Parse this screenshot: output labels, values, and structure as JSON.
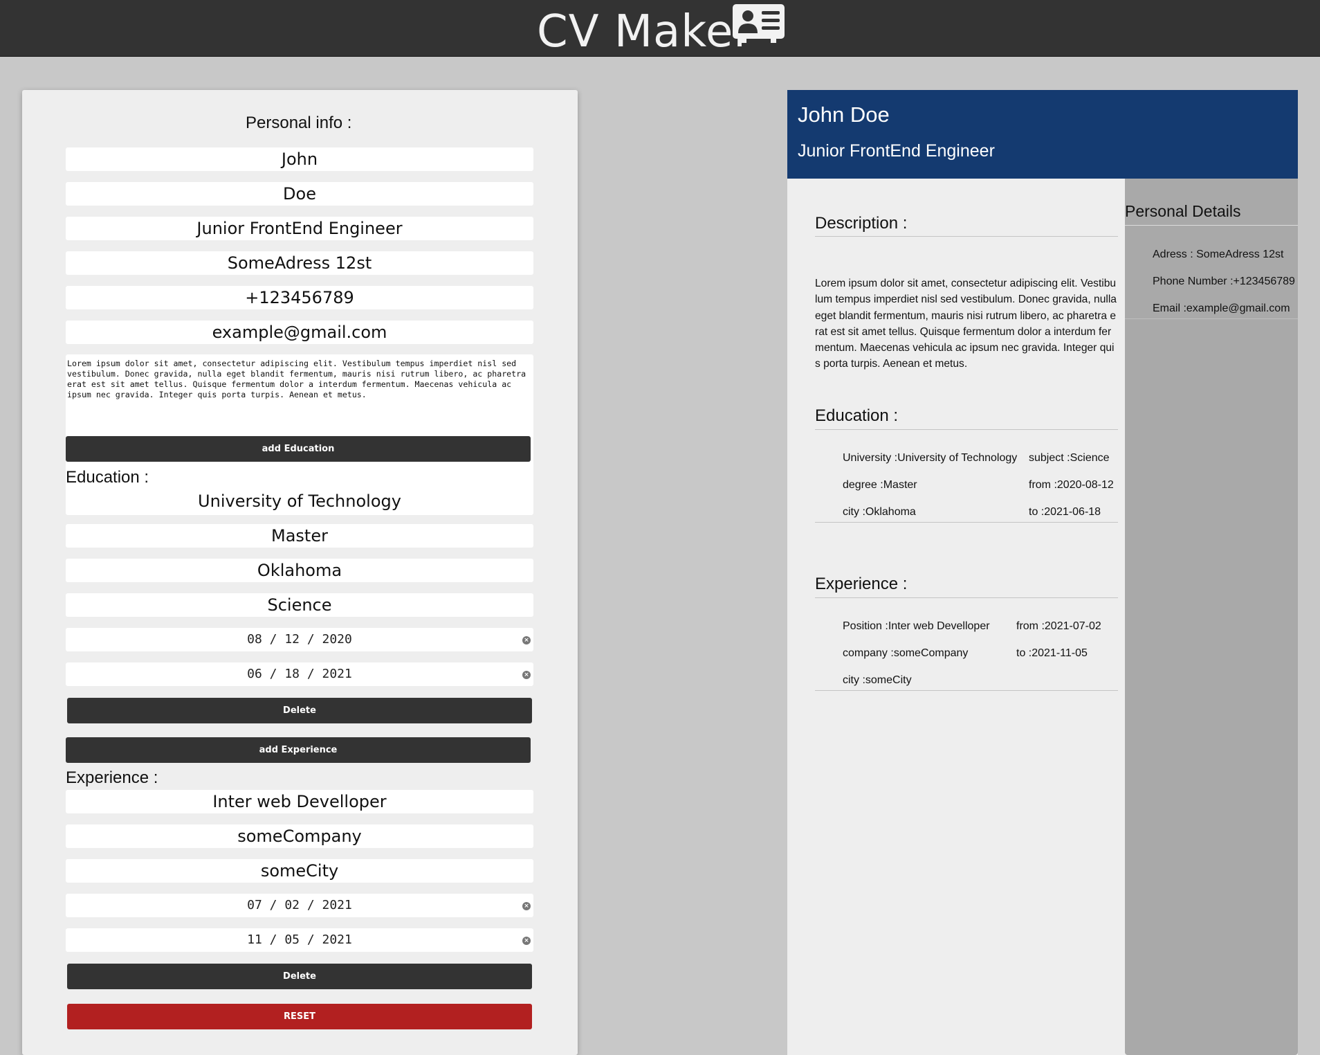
{
  "header": {
    "title": "CV Maker",
    "icon": "contact-card-icon"
  },
  "form": {
    "personal_heading": "Personal info :",
    "first_name": "John",
    "last_name": "Doe",
    "job_title": "Junior FrontEnd Engineer",
    "address": "SomeAdress 12st",
    "phone": "+123456789",
    "email": "example@gmail.com",
    "description": "Lorem ipsum dolor sit amet, consectetur adipiscing elit. Vestibulum tempus imperdiet nisl sed vestibulum. Donec gravida, nulla eget blandit fermentum, mauris nisi rutrum libero, ac pharetra erat est sit amet tellus. Quisque fermentum dolor a interdum fermentum. Maecenas vehicula ac ipsum nec gravida. Integer quis porta turpis. Aenean et metus.",
    "add_education_label": "add Education",
    "education_heading": "Education :",
    "education": {
      "university": "University of Technology",
      "degree": "Master",
      "city": "Oklahoma",
      "subject": "Science",
      "from": "08 / 12 / 2020",
      "to": "06 / 18 / 2021",
      "delete_label": "Delete"
    },
    "add_experience_label": "add Experience",
    "experience_heading": "Experience :",
    "experience": {
      "position": "Inter web Develloper",
      "company": "someCompany",
      "city": "someCity",
      "from": "07 / 02 / 2021",
      "to": "11 / 05 / 2021",
      "delete_label": "Delete"
    },
    "reset_label": "RESET"
  },
  "cv": {
    "name": "John Doe",
    "job_title": "Junior FrontEnd Engineer",
    "description_heading": "Description :",
    "description": "Lorem ipsum dolor sit amet, consectetur adipiscing elit. Vestibulum tempus imperdiet nisl sed vestibulum. Donec gravida, nulla eget blandit fermentum, mauris nisi rutrum libero, ac pharetra erat est sit amet tellus. Quisque fermentum dolor a interdum fermentum. Maecenas vehicula ac ipsum nec gravida. Integer quis porta turpis. Aenean et metus.",
    "education_heading": "Education :",
    "education": {
      "university": "University :University of Technology",
      "degree": "degree :Master",
      "city": "city :Oklahoma",
      "subject": "subject :Science",
      "from": "from :2020-08-12",
      "to": "to :2021-06-18"
    },
    "experience_heading": "Experience :",
    "experience": {
      "position": "Position :Inter web Develloper",
      "company": "company :someCompany",
      "city": "city :someCity",
      "from": "from :2021-07-02",
      "to": "to :2021-11-05"
    },
    "sidebar": {
      "title": "Personal Details",
      "address": "Adress : SomeAdress 12st",
      "phone": "Phone Number :+123456789",
      "email": "Email :example@gmail.com"
    }
  },
  "colors": {
    "topbar": "#333333",
    "cv_header": "#143a70",
    "reset_button": "#b22020",
    "sidebar": "#a9a9a9"
  }
}
